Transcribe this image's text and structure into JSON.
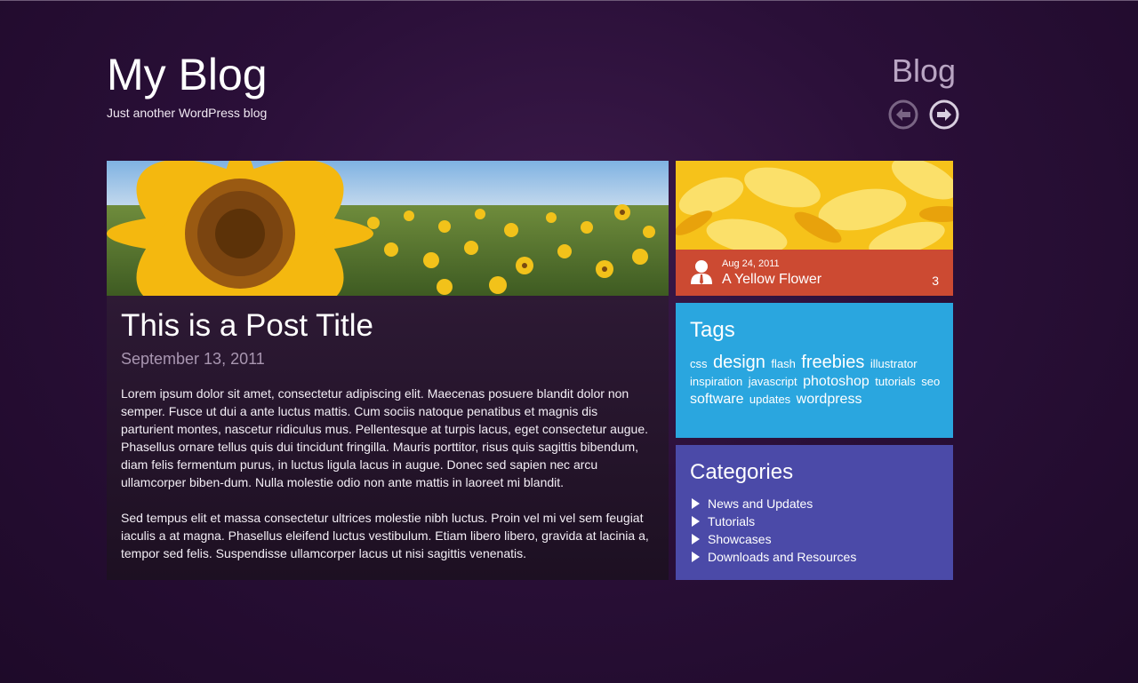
{
  "header": {
    "site_title": "My Blog",
    "tagline": "Just another WordPress blog",
    "section_label": "Blog"
  },
  "post": {
    "title": "This is a Post Title",
    "date": "September 13, 2011",
    "paragraphs": [
      "Lorem ipsum dolor sit amet, consectetur adipiscing elit. Maecenas posuere blandit dolor non semper. Fusce ut dui a ante luctus mattis. Cum sociis natoque penatibus et magnis dis parturient montes, nascetur ridiculus mus. Pellentesque at turpis lacus, eget consectetur augue. Phasellus ornare tellus quis dui tincidunt fringilla. Mauris porttitor, risus quis sagittis bibendum, diam felis fermentum purus, in luctus ligula lacus in augue. Donec sed sapien nec arcu ullamcorper biben-dum. Nulla molestie odio non ante mattis in laoreet mi blandit.",
      "Sed tempus elit et massa consectetur ultrices molestie nibh luctus. Proin vel mi vel sem feugiat iaculis a at magna. Phasellus eleifend luctus vestibulum. Etiam libero libero, gravida at lacinia a, tempor sed felis. Suspendisse ullamcorper lacus ut nisi sagittis venenatis."
    ]
  },
  "featured": {
    "date": "Aug 24, 2011",
    "title": "A Yellow Flower",
    "count": "3"
  },
  "tags": {
    "heading": "Tags",
    "items": [
      {
        "label": "css",
        "size": "sm"
      },
      {
        "label": "design",
        "size": "lg"
      },
      {
        "label": "flash",
        "size": "sm"
      },
      {
        "label": "freebies",
        "size": "lg"
      },
      {
        "label": "illustrator",
        "size": "sm"
      },
      {
        "label": "inspiration",
        "size": "sm"
      },
      {
        "label": "javascript",
        "size": "sm"
      },
      {
        "label": "photoshop",
        "size": "md"
      },
      {
        "label": "tutorials",
        "size": "sm"
      },
      {
        "label": "seo",
        "size": "sm"
      },
      {
        "label": "software",
        "size": "md"
      },
      {
        "label": "updates",
        "size": "sm"
      },
      {
        "label": "wordpress",
        "size": "md"
      }
    ]
  },
  "categories": {
    "heading": "Categories",
    "items": [
      "News and Updates",
      "Tutorials",
      "Showcases",
      "Downloads and Resources"
    ]
  },
  "icons": {
    "prev": "arrow-left-circle-icon",
    "next": "arrow-right-circle-icon",
    "author": "user-icon",
    "category_bullet": "triangle-right-icon"
  },
  "colors": {
    "background": "#2a0f38",
    "featured_tile": "#cc4a32",
    "tags_tile": "#2aa6df",
    "categories_tile": "#4b4aa8",
    "muted_text": "#a996b1"
  }
}
